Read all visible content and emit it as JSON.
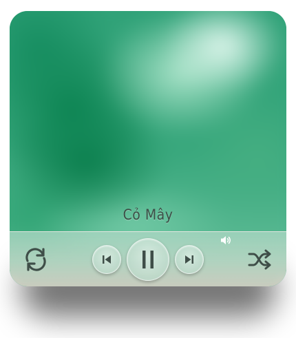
{
  "player": {
    "song_title": "Cỏ Mây"
  },
  "controls": {
    "repeat_icon": "repeat-icon",
    "previous_icon": "skip-previous-icon",
    "play_pause_icon": "pause-icon",
    "next_icon": "skip-next-icon",
    "shuffle_icon": "shuffle-icon",
    "volume_icon": "volume-icon"
  },
  "colors": {
    "artwork_accent": "#2fa177",
    "icon_color": "#3f4e48"
  }
}
